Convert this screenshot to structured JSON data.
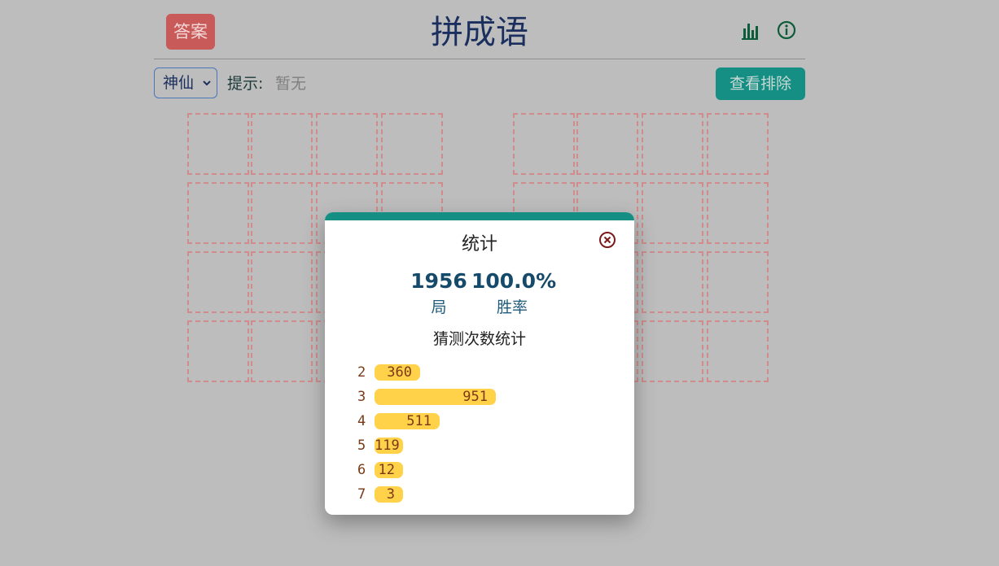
{
  "header": {
    "answer_label": "答案",
    "title": "拼成语",
    "stats_icon": "bar-chart-icon",
    "info_icon": "info-icon"
  },
  "toolbar": {
    "category_selected": "神仙",
    "hint_label": "提示:",
    "hint_value": "暂无",
    "exclude_label": "查看排除"
  },
  "grids": {
    "count": 2,
    "rows": 4,
    "cols": 4
  },
  "stats_modal": {
    "title": "统计",
    "close_icon": "close-circle-icon",
    "games_value": "1956",
    "games_label": "局",
    "winrate_value": "100.0%",
    "winrate_label": "胜率",
    "distribution_title": "猜测次数统计",
    "distribution": [
      {
        "guess": "2",
        "count": 360
      },
      {
        "guess": "3",
        "count": 951
      },
      {
        "guess": "4",
        "count": 511
      },
      {
        "guess": "5",
        "count": 119
      },
      {
        "guess": "6",
        "count": 12
      },
      {
        "guess": "7",
        "count": 3
      }
    ]
  },
  "colors": {
    "background": "#bdbdbd",
    "accent": "#158e84",
    "answer_button": "#c85a5a",
    "bar": "#ffd24a",
    "cell_border": "#d08c8c"
  }
}
